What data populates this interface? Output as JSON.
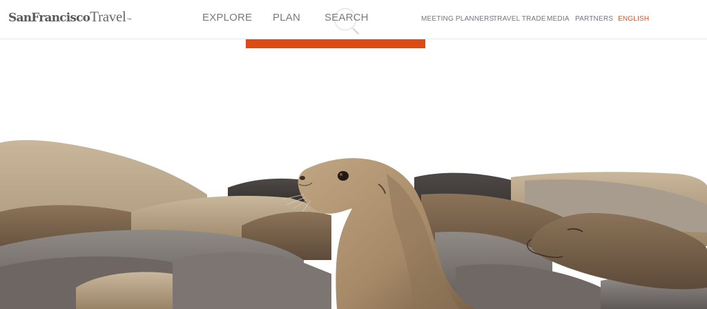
{
  "brand": {
    "logo_bold": "SanFrancisco",
    "logo_light": "Travel",
    "trademark": "™",
    "accent_color": "#dd4a13"
  },
  "main_nav": {
    "explore": "EXPLORE",
    "plan": "PLAN",
    "search": "SEARCH"
  },
  "utility_nav": {
    "meeting_planners": "MEETING PLANNERS",
    "travel_trade": "TRAVEL TRADE",
    "media": "MEDIA",
    "partners": "PARTNERS",
    "language": "ENGLISH"
  },
  "icons": {
    "search": "search-icon"
  }
}
